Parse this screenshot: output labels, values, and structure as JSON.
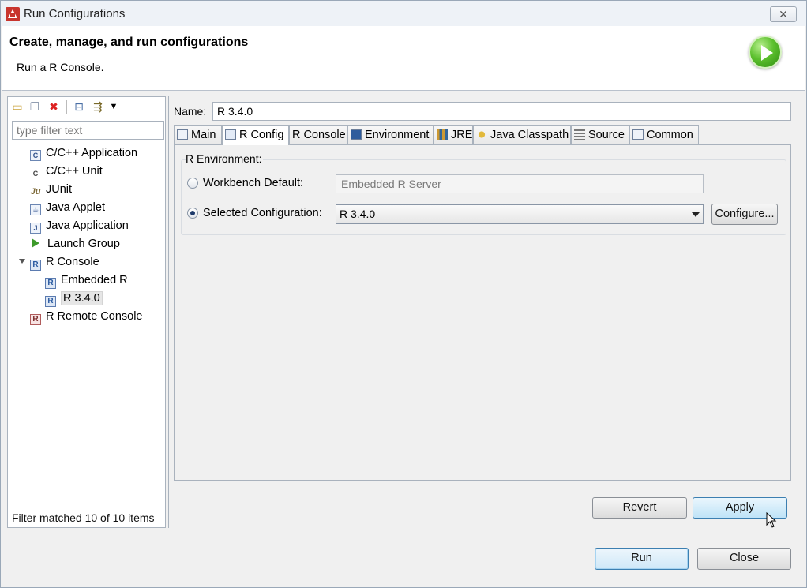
{
  "window": {
    "title": "Run Configurations",
    "close_glyph": "✕"
  },
  "header": {
    "title": "Create, manage, and run configurations",
    "subtitle": "Run a R Console."
  },
  "left_panel": {
    "toolbar_icons": [
      "new-config-icon",
      "duplicate-icon",
      "delete-icon",
      "collapse-all-icon",
      "filter-icon",
      "dropdown-arrow-icon"
    ],
    "filter_placeholder": "type filter text",
    "tree": [
      {
        "label": "C/C++ Application",
        "icon": "c-app-icon",
        "glyph": "C"
      },
      {
        "label": "C/C++ Unit",
        "icon": "c-unit-icon",
        "glyph": "C"
      },
      {
        "label": "JUnit",
        "icon": "junit-icon",
        "glyph": "Ju"
      },
      {
        "label": "Java Applet",
        "icon": "java-applet-icon",
        "glyph": "☕"
      },
      {
        "label": "Java Application",
        "icon": "java-app-icon",
        "glyph": "J"
      },
      {
        "label": "Launch Group",
        "icon": "launch-group-icon",
        "glyph": ""
      },
      {
        "label": "R Console",
        "icon": "r-console-icon",
        "glyph": "R"
      },
      {
        "label": "Embedded R",
        "icon": "r-console-icon",
        "glyph": "R"
      },
      {
        "label": "R 3.4.0",
        "icon": "r-console-icon",
        "glyph": "R"
      },
      {
        "label": "R Remote Console",
        "icon": "r-remote-console-icon",
        "glyph": "R"
      }
    ],
    "status": "Filter matched 10 of 10 items"
  },
  "right_panel": {
    "name_label": "Name:",
    "name_value": "R 3.4.0",
    "tabs": [
      {
        "label": "Main",
        "icon": "main-tab-icon"
      },
      {
        "label": "R Config",
        "icon": "r-config-tab-icon"
      },
      {
        "label": "R Console",
        "icon": ""
      },
      {
        "label": "Environment",
        "icon": "environment-tab-icon"
      },
      {
        "label": "JRE",
        "icon": "jre-tab-icon"
      },
      {
        "label": "Java Classpath",
        "icon": "classpath-tab-icon"
      },
      {
        "label": "Source",
        "icon": "source-tab-icon"
      },
      {
        "label": "Common",
        "icon": "common-tab-icon"
      }
    ],
    "active_tab": "R Config",
    "group_label": "R Environment:",
    "workbench_default_label": "Workbench Default:",
    "workbench_default_value": "Embedded R Server",
    "selected_config_label": "Selected Configuration:",
    "selected_config_value": "R 3.4.0",
    "configure_button": "Configure...",
    "revert_button": "Revert",
    "apply_button": "Apply"
  },
  "footer": {
    "run_button": "Run",
    "close_button": "Close"
  }
}
